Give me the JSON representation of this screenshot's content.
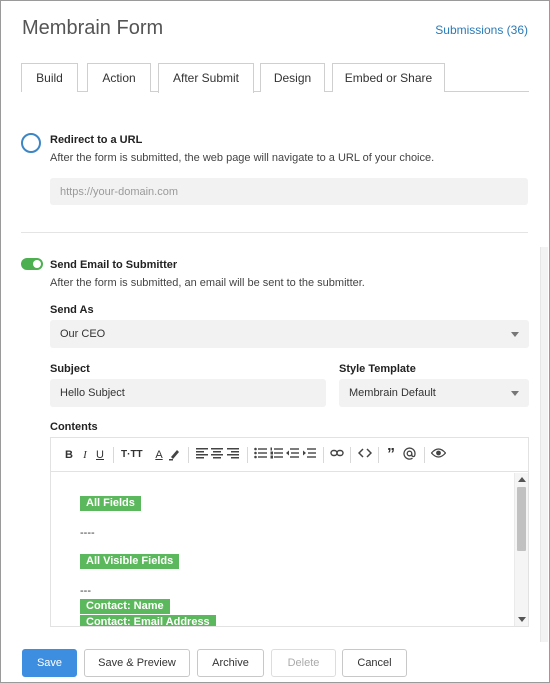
{
  "header": {
    "title": "Membrain Form",
    "submissions_link": "Submissions (36)"
  },
  "tabs": [
    {
      "label": "Build",
      "active": false
    },
    {
      "label": "Action",
      "active": false
    },
    {
      "label": "After Submit",
      "active": true
    },
    {
      "label": "Design",
      "active": false
    },
    {
      "label": "Embed or Share",
      "active": false
    }
  ],
  "redirect": {
    "title": "Redirect to a URL",
    "description": "After the form is submitted, the web page will navigate to a URL of your choice.",
    "url_value": "",
    "url_placeholder": "https://your-domain.com",
    "selected": false
  },
  "send_email": {
    "enabled": true,
    "title": "Send Email to Submitter",
    "description": "After the form is submitted, an email will be sent to the submitter.",
    "send_as_label": "Send As",
    "send_as_value": "Our CEO",
    "subject_label": "Subject",
    "subject_value": "Hello Subject",
    "style_template_label": "Style Template",
    "style_template_value": "Membrain Default",
    "contents_label": "Contents"
  },
  "toolbar": {
    "bold": "B",
    "italic": "I",
    "underline": "U",
    "font_size": "T·TT",
    "font_color": "A",
    "quote": "”"
  },
  "editor_content": {
    "tag_all_fields": "All Fields",
    "dashes_1": "----",
    "tag_all_visible_fields": "All Visible Fields",
    "dashes_2": "---",
    "tag_contact_name": "Contact: Name",
    "tag_contact_email": "Contact: Email Address"
  },
  "colors": {
    "primary": "#3d8ee0",
    "link": "#2a7ab8",
    "toggle_on": "#4caf50",
    "merge_tag": "#5cb85c"
  },
  "footer": {
    "save": "Save",
    "save_preview": "Save & Preview",
    "archive": "Archive",
    "delete": "Delete",
    "cancel": "Cancel"
  }
}
